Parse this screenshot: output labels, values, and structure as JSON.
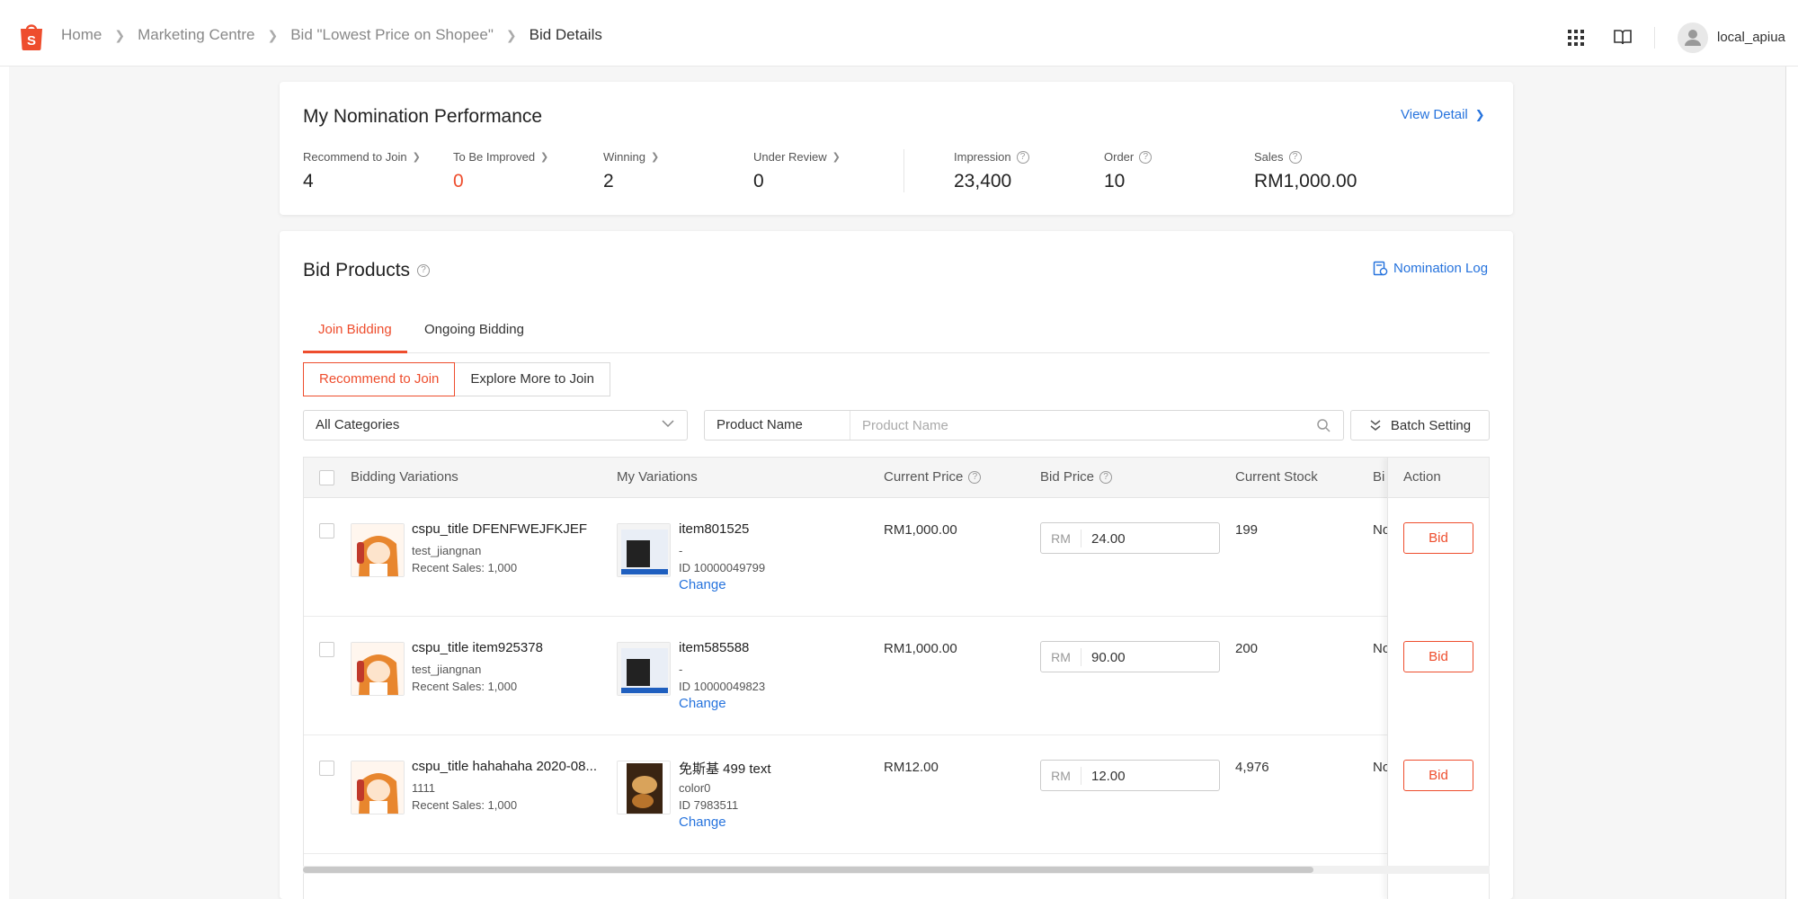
{
  "header": {
    "breadcrumb": [
      "Home",
      "Marketing Centre",
      "Bid \"Lowest Price on Shopee\"",
      "Bid Details"
    ],
    "username": "local_apiua",
    "brand_color": "#ee4d2d"
  },
  "performance": {
    "title": "My Nomination Performance",
    "view_detail": "View Detail",
    "metrics": [
      {
        "label": "Recommend to Join",
        "value": "4"
      },
      {
        "label": "To Be Improved",
        "value": "0"
      },
      {
        "label": "Winning",
        "value": "2"
      },
      {
        "label": "Under Review",
        "value": "0"
      },
      {
        "label": "Impression",
        "value": "23,400"
      },
      {
        "label": "Order",
        "value": "10"
      },
      {
        "label": "Sales",
        "value": "RM1,000.00"
      }
    ]
  },
  "bid_products": {
    "title": "Bid Products",
    "nomination_log": "Nomination Log",
    "tabs": [
      "Join Bidding",
      "Ongoing Bidding"
    ],
    "segments": [
      "Recommend to Join",
      "Explore More to Join"
    ],
    "category_select": "All Categories",
    "search_type": "Product Name",
    "search_placeholder": "Product Name",
    "batch_setting": "Batch Setting",
    "columns": [
      "Bidding Variations",
      "My Variations",
      "Current Price",
      "Bid Price",
      "Current Stock",
      "Bi",
      "Action"
    ],
    "rows": [
      {
        "name": "cspu_title DFENFWEJFKJEF",
        "shop": "test_jiangnan",
        "recent_sales": "Recent Sales: 1,000",
        "variation": "item801525",
        "variation_sub": "-",
        "variation_id": "ID 10000049799",
        "change": "Change",
        "current_price": "RM1,000.00",
        "currency": "RM",
        "bid_price": "24.00",
        "stock": "199",
        "truncated": "No",
        "action": "Bid"
      },
      {
        "name": "cspu_title item925378",
        "shop": "test_jiangnan",
        "recent_sales": "Recent Sales: 1,000",
        "variation": "item585588",
        "variation_sub": "-",
        "variation_id": "ID 10000049823",
        "change": "Change",
        "current_price": "RM1,000.00",
        "currency": "RM",
        "bid_price": "90.00",
        "stock": "200",
        "truncated": "No",
        "action": "Bid"
      },
      {
        "name": "cspu_title hahahaha 2020-08...",
        "shop": "1111",
        "recent_sales": "Recent Sales: 1,000",
        "variation": "免斯基 499 text",
        "variation_sub": "color0",
        "variation_id": "ID 7983511",
        "change": "Change",
        "current_price": "RM12.00",
        "currency": "RM",
        "bid_price": "12.00",
        "stock": "4,976",
        "truncated": "No",
        "action": "Bid"
      }
    ]
  }
}
